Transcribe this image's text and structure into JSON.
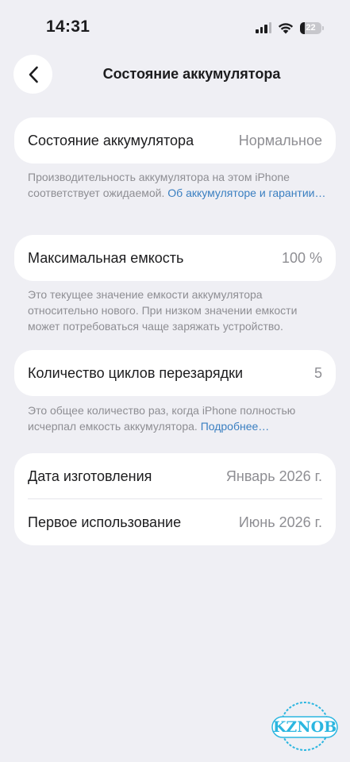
{
  "status_bar": {
    "time": "14:31",
    "battery_level": "22",
    "icons": [
      "cellular-signal-icon",
      "wifi-icon",
      "battery-icon"
    ]
  },
  "nav": {
    "title": "Состояние аккумулятора",
    "back_icon": "chevron-left-icon"
  },
  "health": {
    "label": "Состояние аккумулятора",
    "value": "Нормальное",
    "note": "Производительность аккумулятора на этом iPhone соответствует ожидаемой.",
    "link": "Об аккумуляторе и гарантии…"
  },
  "capacity": {
    "label": "Максимальная емкость",
    "value": "100 %",
    "note": "Это текущее значение емкости аккумулятора относительно нового. При низком значении емкости может потребоваться чаще заряжать устройство."
  },
  "cycles": {
    "label": "Количество циклов перезарядки",
    "value": "5",
    "note": "Это общее количество раз, когда iPhone полностью исчерпал емкость аккумулятора.",
    "link": "Подробнее…"
  },
  "dates": {
    "manufacture_label": "Дата изготовления",
    "manufacture_value": "Январь 2026 г.",
    "first_use_label": "Первое использование",
    "first_use_value": "Июнь 2026 г."
  },
  "watermark": {
    "text": "KZNOB"
  },
  "colors": {
    "background": "#efeff4",
    "card": "#ffffff",
    "link": "#3a7fc1",
    "secondary_text": "#8e8e93",
    "watermark": "#2bb6e0"
  }
}
